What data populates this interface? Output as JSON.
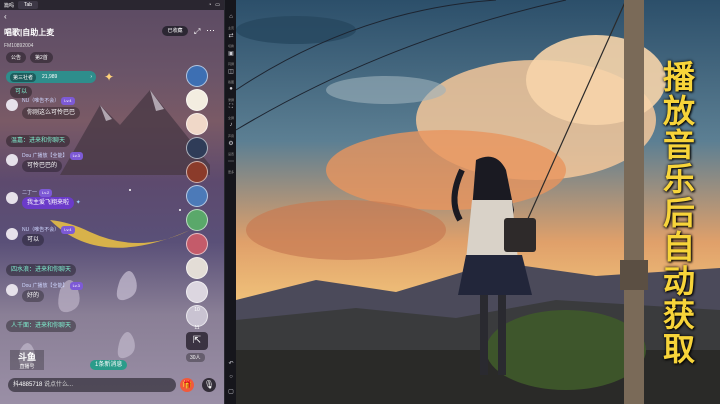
{
  "statusbar": {
    "time": "篇吗",
    "tab": "Tab",
    "icons": [
      "wifi-icon",
      "battery-icon"
    ]
  },
  "room": {
    "title": "唱歌|自助上麦",
    "id": "FM10892004",
    "collect_label": "已收藏",
    "chips": [
      "公告",
      "第2首"
    ],
    "rank_label": "第三社者",
    "rank_value": "21,989"
  },
  "chat": [
    {
      "kind": "sys",
      "text": "可以"
    },
    {
      "kind": "user",
      "name": "NU（唯告不会）",
      "level": "Lv.4",
      "text": "你刚这么可怜巴巴"
    },
    {
      "kind": "sys",
      "text": "温嘉：进来和你聊天"
    },
    {
      "kind": "user",
      "name": "Dou 广播放【全能】",
      "level": "Lv.3",
      "text": "可怜巴巴的"
    },
    {
      "kind": "user",
      "name": "二丁一",
      "level": "Lv.2",
      "text": "我主爱飞翔来啦"
    },
    {
      "kind": "user",
      "name": "NU（唯告不会）",
      "level": "Lv.4",
      "text": "可以"
    },
    {
      "kind": "sys",
      "text": "四水浪：进来和你聊天"
    },
    {
      "kind": "user",
      "name": "Dou 广播放【全能】",
      "level": "Lv.3",
      "text": "好的"
    },
    {
      "kind": "sys",
      "text": "人千面：进来和你聊天"
    }
  ],
  "leaderboard": {
    "badges": [
      "",
      "",
      "",
      "",
      "",
      "",
      "",
      "",
      "",
      "",
      "10",
      "11"
    ],
    "count_label": "30人"
  },
  "new_messages": "1条新消息",
  "input": {
    "placeholder": "说点什么..."
  },
  "logo": {
    "line1": "斗鱼",
    "line2": "直播号"
  },
  "watermark_id": "抖4885718",
  "toolbar_items": [
    "主页",
    "切换",
    "同屏",
    "截图",
    "录屏",
    "全屏",
    "声音",
    "设置",
    "更多"
  ],
  "caption": "播放音乐后自动获取",
  "accent": {
    "teal": "#2e8e8c",
    "caption": "#f7d43a"
  }
}
